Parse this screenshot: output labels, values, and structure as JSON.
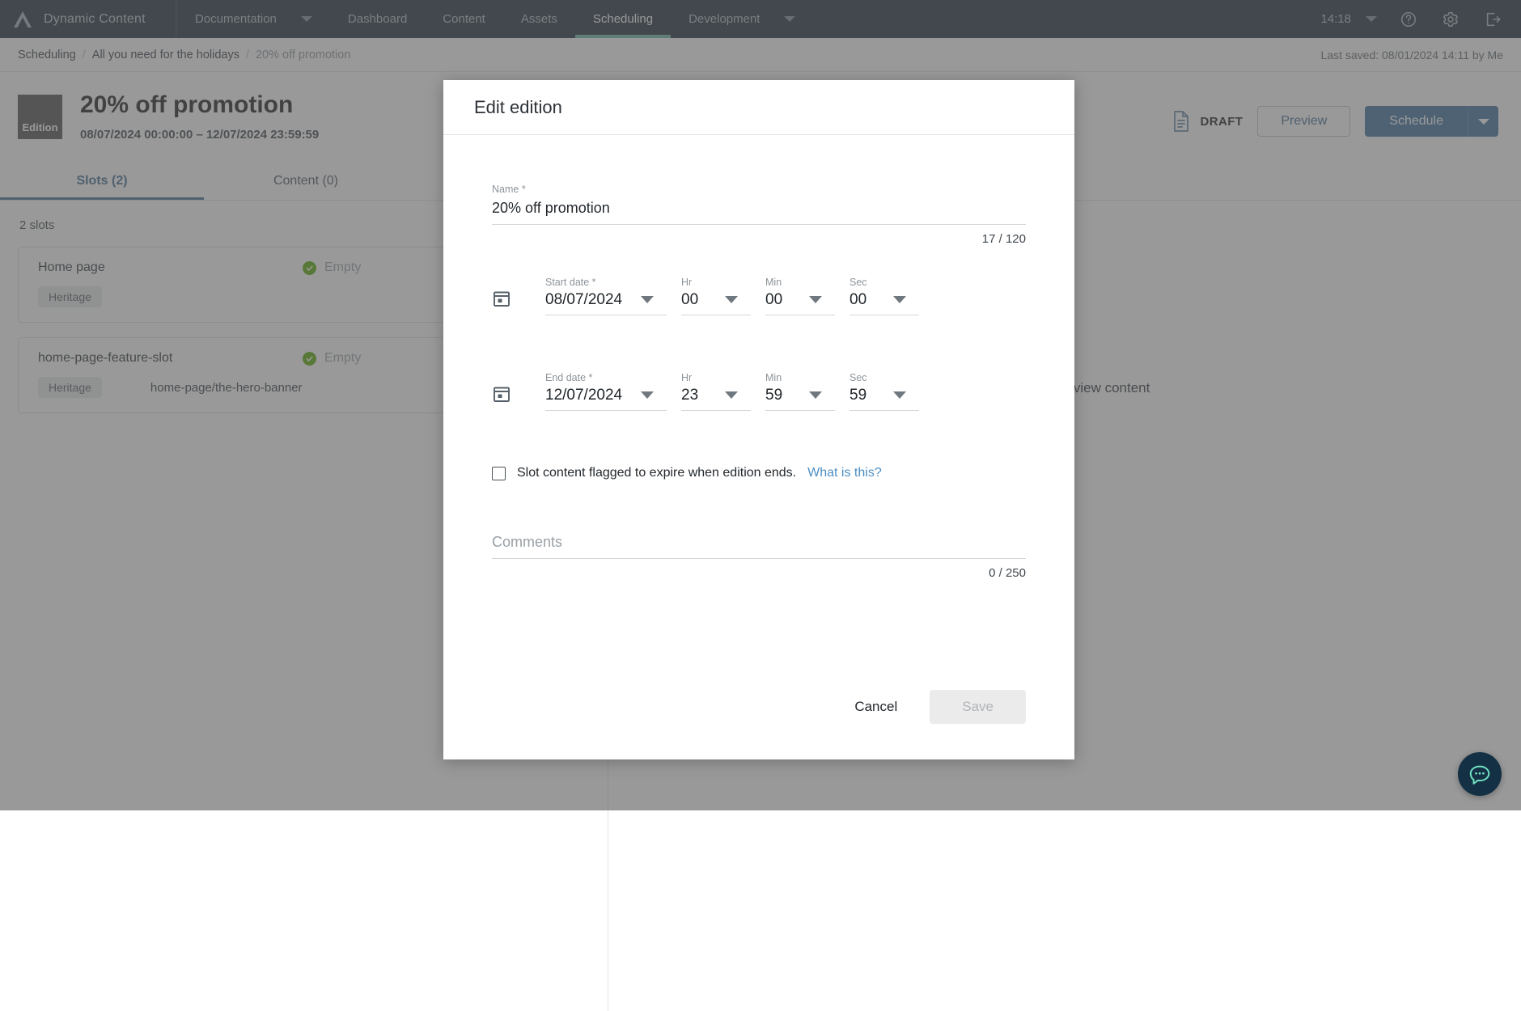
{
  "topnav": {
    "brand": "Dynamic Content",
    "items": [
      {
        "label": "Documentation",
        "has_caret": true,
        "active": false
      },
      {
        "label": "Dashboard",
        "has_caret": false,
        "active": false
      },
      {
        "label": "Content",
        "has_caret": false,
        "active": false
      },
      {
        "label": "Assets",
        "has_caret": false,
        "active": false
      },
      {
        "label": "Scheduling",
        "has_caret": false,
        "active": true
      },
      {
        "label": "Development",
        "has_caret": true,
        "active": false
      }
    ],
    "clock": "14:18",
    "icons": [
      "help-icon",
      "gear-icon",
      "sign-out-icon"
    ]
  },
  "breadcrumb": {
    "items": [
      "Scheduling",
      "All you need for the holidays",
      "20% off promotion"
    ],
    "separator": "/",
    "last_saved": "Last saved: 08/01/2024 14:11 by Me"
  },
  "page_header": {
    "badge": "Edition",
    "title": "20% off promotion",
    "subtitle": "08/07/2024 00:00:00  –  12/07/2024 23:59:59",
    "status": "DRAFT",
    "preview_label": "Preview",
    "schedule_label": "Schedule"
  },
  "tabs": [
    {
      "label": "Slots (2)",
      "active": true
    },
    {
      "label": "Content (0)",
      "active": false
    }
  ],
  "slots_panel": {
    "count_label": "2 slots",
    "slots": [
      {
        "name": "Home page",
        "status": "Empty",
        "chip": "Heritage",
        "path": ""
      },
      {
        "name": "home-page-feature-slot",
        "status": "Empty",
        "chip": "Heritage",
        "path": "home-page/the-hero-banner"
      }
    ]
  },
  "right_pane": {
    "empty_message": "Select a slot to view content"
  },
  "modal": {
    "title": "Edit edition",
    "name_field": {
      "label": "Name *",
      "value": "20% off promotion",
      "placeholder": "Name",
      "counter": "17 / 120"
    },
    "start": {
      "date_label": "Start date *",
      "date_value": "08/07/2024",
      "hr_label": "Hr",
      "hr_value": "00",
      "min_label": "Min",
      "min_value": "00",
      "sec_label": "Sec",
      "sec_value": "00"
    },
    "end": {
      "date_label": "End date *",
      "date_value": "12/07/2024",
      "hr_label": "Hr",
      "hr_value": "23",
      "min_label": "Min",
      "min_value": "59",
      "sec_label": "Sec",
      "sec_value": "59"
    },
    "expire_checkbox": {
      "checked": false,
      "label": "Slot content flagged to expire when edition ends.",
      "link": "What is this?"
    },
    "comments": {
      "placeholder": "Comments",
      "value": "",
      "counter": "0 / 250"
    },
    "cancel_label": "Cancel",
    "save_label": "Save"
  },
  "colors": {
    "topnav_bg": "#1b2a38",
    "accent_green": "#6ab5a3",
    "primary_blue": "#3a6f9f",
    "link_blue": "#4e8fc4",
    "status_green": "#56a902",
    "chat_bg": "#143044",
    "chat_icon": "#6fe0c0"
  }
}
